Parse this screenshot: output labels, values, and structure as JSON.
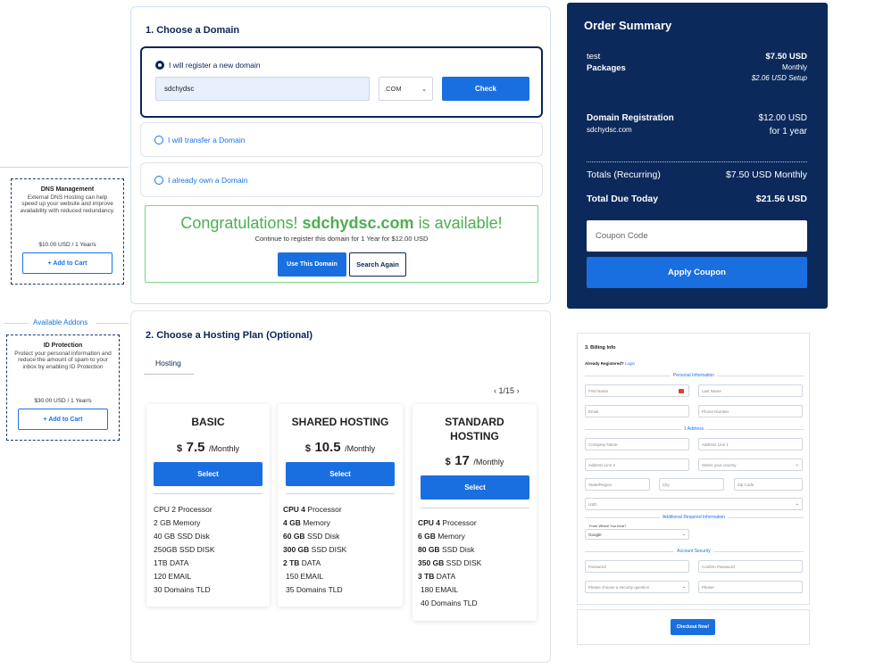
{
  "addons": {
    "section_title": "Available Addons",
    "items": [
      {
        "title": "DNS Management",
        "desc": "External DNS Hosting can help speed up your website and improve availability with reduced redundancy.",
        "price": "$10.00 USD / 1 Year/s",
        "button": "+ Add to Cart"
      },
      {
        "title": "ID Protection",
        "desc": "Protect your personal information and reduce the amount of spam to your inbox by enabling ID Protection",
        "price": "$30.00 USD / 1 Year/s",
        "button": "+ Add to Cart"
      }
    ]
  },
  "domain": {
    "title": "1. Choose a Domain",
    "options": [
      {
        "label": "I will register a new domain",
        "selected": true
      },
      {
        "label": "I will transfer a Domain",
        "selected": false
      },
      {
        "label": "I already own a Domain",
        "selected": false
      }
    ],
    "input_value": "sdchydsc",
    "tld_selected": ".COM",
    "check_label": "Check",
    "congrats": {
      "prefix": "Congratulations!",
      "domain": "sdchydsc.com",
      "suffix": "is available!",
      "sub": "Continue to register this domain for 1 Year for $12.00 USD",
      "use_label": "Use This Domain",
      "search_label": "Search Again"
    }
  },
  "hosting": {
    "title": "2. Choose a Hosting Plan (Optional)",
    "tab": "Hosting",
    "pager": "1/15",
    "plans": [
      {
        "name": "BASIC",
        "currency": "$",
        "amount": "7.5",
        "period": "/Monthly",
        "select": "Select",
        "features": [
          {
            "b": "",
            "t": "CPU 2 Processor"
          },
          {
            "b": "",
            "t": "2 GB Memory"
          },
          {
            "b": "",
            "t": "40 GB SSD Disk"
          },
          {
            "b": "",
            "t": "250GB SSD DISK"
          },
          {
            "b": "",
            "t": "1TB DATA"
          },
          {
            "b": "",
            "t": "120 EMAIL"
          },
          {
            "b": "",
            "t": "30 Domains TLD"
          }
        ]
      },
      {
        "name": "SHARED HOSTING",
        "currency": "$",
        "amount": "10.5",
        "period": "/Monthly",
        "select": "Select",
        "features": [
          {
            "b": "CPU 4",
            "t": "Processor"
          },
          {
            "b": "4 GB",
            "t": "Memory"
          },
          {
            "b": "60 GB",
            "t": "SSD Disk"
          },
          {
            "b": "300 GB",
            "t": "SSD DISK"
          },
          {
            "b": "2 TB",
            "t": "DATA"
          },
          {
            "b": "",
            "t": "150 EMAIL"
          },
          {
            "b": "",
            "t": "35 Domains TLD"
          }
        ]
      },
      {
        "name": "STANDARD HOSTING",
        "currency": "$",
        "amount": "17",
        "period": "/Monthly",
        "select": "Select",
        "features": [
          {
            "b": "CPU 4",
            "t": "Processor"
          },
          {
            "b": "6 GB",
            "t": "Memory"
          },
          {
            "b": "80 GB",
            "t": "SSD Disk"
          },
          {
            "b": "350 GB",
            "t": "SSD DISK"
          },
          {
            "b": "3 TB",
            "t": "DATA"
          },
          {
            "b": "",
            "t": "180 EMAIL"
          },
          {
            "b": "",
            "t": "40 Domains TLD"
          }
        ]
      }
    ]
  },
  "summary": {
    "title": "Order Summary",
    "item_name": "test",
    "item_group": "Packages",
    "item_price": "$7.50 USD",
    "item_cycle": "Monthly",
    "item_setup": "$2.06 USD Setup",
    "domain_label": "Domain Registration",
    "domain_name": "sdchydsc.com",
    "domain_price": "$12.00 USD",
    "domain_term": "for 1 year",
    "totals_label": "Totals (Recurring)",
    "totals_value": "$7.50 USD Monthly",
    "due_label": "Total Due Today",
    "due_value": "$21.56 USD",
    "coupon_placeholder": "Coupon Code",
    "apply_label": "Apply Coupon"
  },
  "billing": {
    "title": "3. Billing Info",
    "registered": "Already Registered?",
    "login": "Login",
    "personal": "Personal Information",
    "first_name": "First Name",
    "last_name": "Last Name",
    "email": "Email",
    "phone": "Phone Number",
    "address_sec": "1 Address",
    "company": "Company Name",
    "address1": "Address Line 1",
    "address2": "Address Line 2",
    "country": "Select your country",
    "state": "State/Region",
    "city": "City",
    "zip": "Zip Code",
    "currency": "USD",
    "additional": "Additional Required Information",
    "heard_label": "From Where You hear?",
    "heard_value": "Google",
    "security": "Account Security",
    "password": "Password",
    "confirm": "Confirm Password",
    "question": "Please choose a security question",
    "answer": "Please",
    "checkout": "Checkout Now!"
  }
}
